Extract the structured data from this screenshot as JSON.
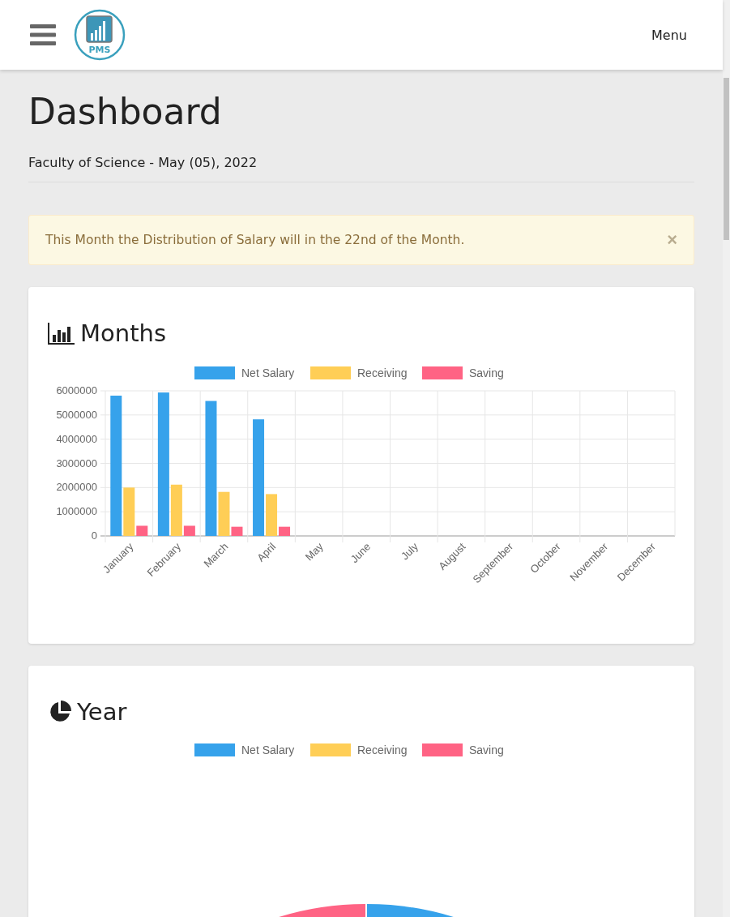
{
  "header": {
    "menu_label": "Menu",
    "logo_text": "PMS"
  },
  "page": {
    "title": "Dashboard",
    "subtitle": "Faculty of Science - May (05), 2022"
  },
  "alert": {
    "message": "This Month the Distribution of Salary will in the 22nd of the Month.",
    "close": "×"
  },
  "months_card": {
    "title": "Months",
    "chart_data": {
      "type": "bar",
      "categories": [
        "January",
        "February",
        "March",
        "April",
        "May",
        "June",
        "July",
        "August",
        "September",
        "October",
        "November",
        "December"
      ],
      "series": [
        {
          "name": "Net Salary",
          "color": "#36a2eb",
          "values": [
            5800000,
            5930000,
            5580000,
            4820000,
            null,
            null,
            null,
            null,
            null,
            null,
            null,
            null
          ]
        },
        {
          "name": "Receiving",
          "color": "#ffce56",
          "values": [
            2000000,
            2120000,
            1820000,
            1730000,
            null,
            null,
            null,
            null,
            null,
            null,
            null,
            null
          ]
        },
        {
          "name": "Saving",
          "color": "#ff6384",
          "values": [
            420000,
            420000,
            380000,
            380000,
            null,
            null,
            null,
            null,
            null,
            null,
            null,
            null
          ]
        }
      ],
      "grid": true,
      "legend": true,
      "ylim": [
        0,
        6000000
      ],
      "yticks": [
        0,
        1000000,
        2000000,
        3000000,
        4000000,
        5000000,
        6000000
      ]
    }
  },
  "year_card": {
    "title": "Year",
    "legend": [
      {
        "name": "Net Salary",
        "color": "#36a2eb"
      },
      {
        "name": "Receiving",
        "color": "#ffce56"
      },
      {
        "name": "Saving",
        "color": "#ff6384"
      }
    ]
  }
}
